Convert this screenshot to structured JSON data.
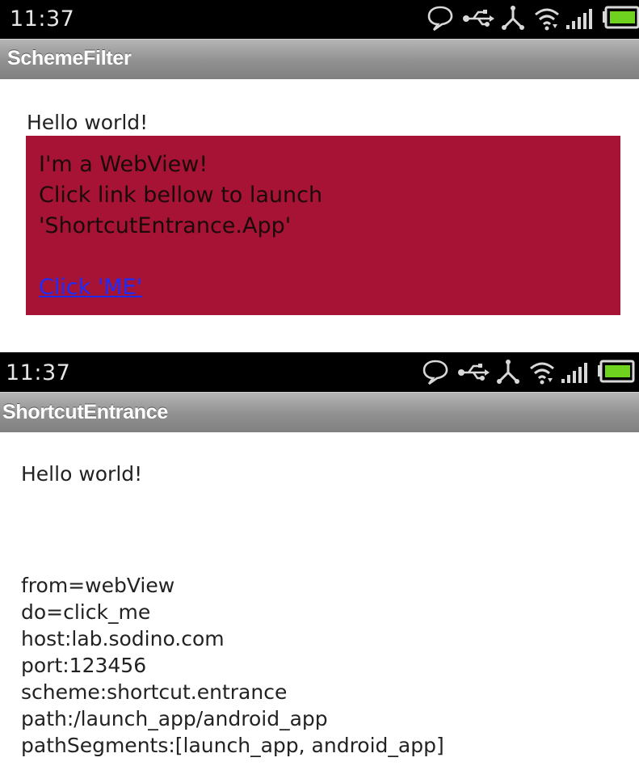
{
  "screen1": {
    "status_time": "11:37",
    "title": "SchemeFilter",
    "hello": "Hello world!",
    "webview": {
      "line1": "I'm a WebView!",
      "line2": "Click link bellow to launch",
      "line3": "'ShortcutEntrance.App'",
      "link": "Click 'ME'"
    }
  },
  "screen2": {
    "status_time": "11:37",
    "title": "ShortcutEntrance",
    "hello": "Hello world!",
    "info": [
      "from=webView",
      "do=click_me",
      "host:lab.sodino.com",
      "port:123456",
      "scheme:shortcut.entrance",
      "path:/launch_app/android_app",
      "pathSegments:[launch_app, android_app]"
    ]
  },
  "status_icons": [
    "chat-bubble-icon",
    "usb-icon",
    "debug-icon",
    "wifi-icon",
    "signal-icon",
    "battery-icon"
  ],
  "colors": {
    "webview_bg": "#a71335",
    "link": "#1a2cff",
    "battery": "#6ed21e"
  }
}
